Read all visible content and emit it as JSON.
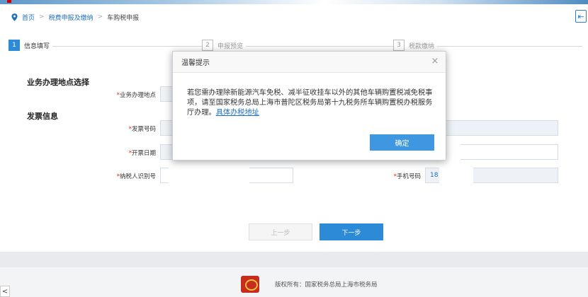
{
  "breadcrumb": {
    "home": "首页",
    "level2": "税费申报及缴纳",
    "current": "车购税申报"
  },
  "steps": [
    {
      "num": "1",
      "label": "信息填写"
    },
    {
      "num": "2",
      "label": "申报预览"
    },
    {
      "num": "3",
      "label": "税款缴纳"
    }
  ],
  "sections": {
    "location": "业务办理地点选择",
    "invoice": "发票信息"
  },
  "form": {
    "req_mark": "*",
    "location_label": "业务办理地点",
    "invoice_no_label": "发票号码",
    "invoice_date_label": "开票日期",
    "taxpayer_id_label": "纳税人识别号",
    "phone_label": "手机号码",
    "phone_value_visible": "18"
  },
  "buttons": {
    "prev": "上一步",
    "next": "下一步"
  },
  "dialog": {
    "title": "温馨提示",
    "close": "×",
    "message": "若您需办理除新能源汽车免税、减半征收挂车以外的其他车辆购置税减免税事项，请至国家税务总局上海市普陀区税务局第十九税务所车辆购置税办税服务厅办理。",
    "link": "具体办税地址",
    "ok": "确定"
  },
  "footer": {
    "copyright": "版权所有：国家税务总局上海市税务局"
  },
  "icons": {
    "exit": "exit-icon",
    "pin": "location-pin-icon",
    "scroll": "scroll-left-icon"
  },
  "colors": {
    "accent": "#2d8ad7",
    "link": "#1f6fbf",
    "required": "#e02020"
  }
}
